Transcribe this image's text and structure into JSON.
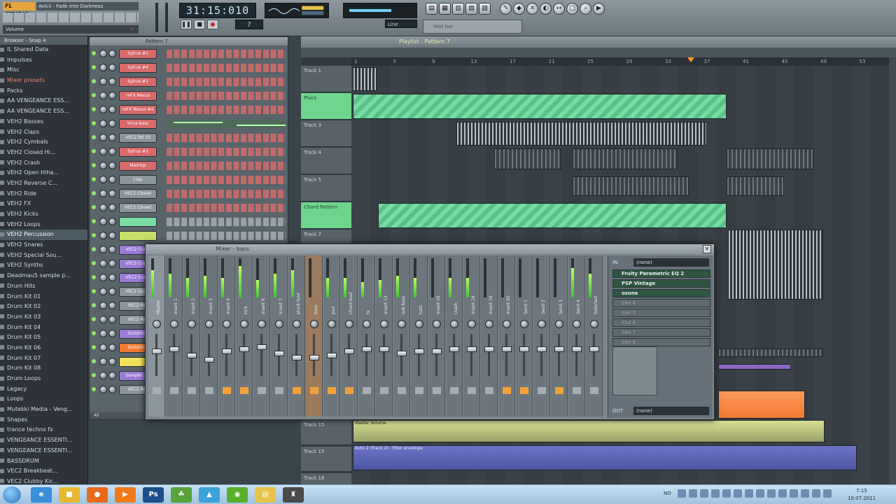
{
  "toolbar": {
    "logo": "FL STUDIO",
    "title": "Avicii - Fade Into Darkness",
    "hint": "Volume",
    "time": "31:15:010",
    "pattern_number": "7",
    "snap": "Line",
    "hint_panel_text": "Hint bar"
  },
  "browser": {
    "header": "Browser - Snap 4",
    "items": [
      {
        "label": "IL Shared Data",
        "style": ""
      },
      {
        "label": "Impulses",
        "style": ""
      },
      {
        "label": "Misc",
        "style": ""
      },
      {
        "label": "Mixer presets",
        "style": "red"
      },
      {
        "label": "Packs",
        "style": ""
      },
      {
        "label": "AA VENGEANCE ESS...",
        "style": ""
      },
      {
        "label": "AA VENGEANCE ESS...",
        "style": ""
      },
      {
        "label": "VEH2 Basses",
        "style": ""
      },
      {
        "label": "VEH2 Claps",
        "style": ""
      },
      {
        "label": "VEH2 Cymbals",
        "style": ""
      },
      {
        "label": "VEH2 Closed Hi...",
        "style": ""
      },
      {
        "label": "VEH2 Crash",
        "style": ""
      },
      {
        "label": "VEH2 Open Hiha...",
        "style": ""
      },
      {
        "label": "VEH2 Reverse C...",
        "style": ""
      },
      {
        "label": "VEH2 Ride",
        "style": ""
      },
      {
        "label": "VEH2 FX",
        "style": ""
      },
      {
        "label": "VEH2 Kicks",
        "style": ""
      },
      {
        "label": "VEH2 Loops",
        "style": ""
      },
      {
        "label": "VEH2 Percussion",
        "style": "sel"
      },
      {
        "label": "VEH2 Snares",
        "style": ""
      },
      {
        "label": "VEH2 Special Sou...",
        "style": ""
      },
      {
        "label": "VEH2 Synths",
        "style": ""
      },
      {
        "label": "Deadmau5 sample p...",
        "style": ""
      },
      {
        "label": "Drum Hits",
        "style": ""
      },
      {
        "label": "Drum Kit 01",
        "style": ""
      },
      {
        "label": "Drum Kit 02",
        "style": ""
      },
      {
        "label": "Drum Kit 03",
        "style": ""
      },
      {
        "label": "Drum Kit 04",
        "style": ""
      },
      {
        "label": "Drum Kit 05",
        "style": ""
      },
      {
        "label": "Drum Kit 06",
        "style": ""
      },
      {
        "label": "Drum Kit 07",
        "style": ""
      },
      {
        "label": "Drum Kit 08",
        "style": ""
      },
      {
        "label": "Drum Loops",
        "style": ""
      },
      {
        "label": "Legacy",
        "style": ""
      },
      {
        "label": "Loops",
        "style": ""
      },
      {
        "label": "Mutekki Media - Veng...",
        "style": ""
      },
      {
        "label": "Shapes",
        "style": ""
      },
      {
        "label": "trance techno fx",
        "style": ""
      },
      {
        "label": "VENGEANCE ESSENTI...",
        "style": ""
      },
      {
        "label": "VENGEANCE ESSENTI...",
        "style": ""
      },
      {
        "label": "BASSDRUM",
        "style": ""
      },
      {
        "label": "VEC2 Breakbeat...",
        "style": ""
      },
      {
        "label": "VEC2 Clubby Kic...",
        "style": ""
      }
    ]
  },
  "sequencer": {
    "title": "Pattern 7",
    "footer": "All",
    "channels": [
      {
        "name": "Sytrus #1",
        "color": "#d86a6a",
        "steps": "red"
      },
      {
        "name": "Sytrus #4",
        "color": "#d86a6a",
        "steps": "red"
      },
      {
        "name": "Sytrus #2",
        "color": "#d86a6a",
        "steps": "red"
      },
      {
        "name": "reFX Nexus",
        "color": "#d86a6a",
        "steps": "red"
      },
      {
        "name": "reFX Nexus #4",
        "color": "#d86a6a",
        "steps": "red"
      },
      {
        "name": "Virus bass",
        "color": "#d86a6a",
        "steps": "roll"
      },
      {
        "name": "VEC2 Bd 10",
        "color": "#8b969c",
        "steps": "red"
      },
      {
        "name": "Sytrus #3",
        "color": "#d86a6a",
        "steps": "red"
      },
      {
        "name": "Mainlop",
        "color": "#d86a6a",
        "steps": "red"
      },
      {
        "name": "Clap",
        "color": "#8b969c",
        "steps": "red"
      },
      {
        "name": "VEC2 Closed",
        "color": "#8b969c",
        "steps": "red"
      },
      {
        "name": "VEC2 Closed",
        "color": "#8b969c",
        "steps": "red"
      },
      {
        "name": "",
        "color": "#79dca2",
        "steps": "grey"
      },
      {
        "name": "",
        "color": "#c7e06a",
        "steps": "grey"
      },
      {
        "name": "VEC2 Crash",
        "color": "#9b7ad8",
        "steps": "grey"
      },
      {
        "name": "VEC2 Crash",
        "color": "#9b7ad8",
        "steps": "grey"
      },
      {
        "name": "VEC2 Crash",
        "color": "#9b7ad8",
        "steps": "grey"
      },
      {
        "name": "VEC2 Ope...",
        "color": "#8b969c",
        "steps": "grey"
      },
      {
        "name": "VEC2 Rev",
        "color": "#8b969c",
        "steps": "grey"
      },
      {
        "name": "VEC2 Rev",
        "color": "#8b969c",
        "steps": "grey"
      },
      {
        "name": "Distortion",
        "color": "#9b7ad8",
        "steps": "grey"
      },
      {
        "name": "Distortion",
        "color": "#ef7a32",
        "steps": "grey"
      },
      {
        "name": "",
        "color": "#f3e05a",
        "steps": "grey"
      },
      {
        "name": "Sampler #1",
        "color": "#9b7ad8",
        "steps": "grey"
      },
      {
        "name": "VEC2 Rev",
        "color": "#8b969c",
        "steps": "grey"
      }
    ]
  },
  "playlist": {
    "title": "Playlist - Pattern 7",
    "timeline": [
      "1",
      "5",
      "9",
      "13",
      "17",
      "21",
      "25",
      "29",
      "33",
      "37",
      "41",
      "45",
      "49",
      "53"
    ],
    "tracks": [
      "Track 1",
      "Pluck",
      "Track 3",
      "Track 4",
      "Track 5",
      "Chord Pattern",
      "Track 7",
      "Track 15",
      "Track 15",
      "Track 16"
    ],
    "automation_clips": [
      "Master Volume",
      "Auto 2 (Track 2) - filter envelope"
    ]
  },
  "mixer": {
    "title": "Mixer - bass",
    "strips": [
      {
        "name": "Master",
        "level": 0.7,
        "fader": 0.35,
        "route": false
      },
      {
        "name": "Insert 1",
        "level": 0.6,
        "fader": 0.3,
        "route": false
      },
      {
        "name": "Insert 2",
        "level": 0.5,
        "fader": 0.45,
        "route": false
      },
      {
        "name": "Insert 3",
        "level": 0.55,
        "fader": 0.55,
        "route": false
      },
      {
        "name": "Insert 4",
        "level": 0.5,
        "fader": 0.35,
        "route": true
      },
      {
        "name": "kick",
        "level": 0.8,
        "fader": 0.3,
        "route": true
      },
      {
        "name": "Insert 6",
        "level": 0.45,
        "fader": 0.25,
        "route": false
      },
      {
        "name": "Insert 7",
        "level": 0.6,
        "fader": 0.4,
        "route": false
      },
      {
        "name": "pluck lead",
        "level": 0.7,
        "fader": 0.5,
        "route": true
      },
      {
        "name": "bass",
        "level": 0.0,
        "fader": 0.5,
        "route": true
      },
      {
        "name": "pad",
        "level": 0.5,
        "fader": 0.45,
        "route": true
      },
      {
        "name": "chord lead",
        "level": 0.5,
        "fader": 0.35,
        "route": true
      },
      {
        "name": "fx",
        "level": 0.4,
        "fader": 0.3,
        "route": false
      },
      {
        "name": "Insert 13",
        "level": 0.45,
        "fader": 0.3,
        "route": false
      },
      {
        "name": "sub bass",
        "level": 0.55,
        "fader": 0.4,
        "route": false
      },
      {
        "name": "hats",
        "level": 0.5,
        "fader": 0.35,
        "route": false
      },
      {
        "name": "Insert 16",
        "level": 0.0,
        "fader": 0.35,
        "route": false
      },
      {
        "name": "crash",
        "level": 0.5,
        "fader": 0.3,
        "route": false
      },
      {
        "name": "Insert 18",
        "level": 0.5,
        "fader": 0.3,
        "route": false
      },
      {
        "name": "Insert 19",
        "level": 0.0,
        "fader": 0.3,
        "route": false
      },
      {
        "name": "Insert 20",
        "level": 0.0,
        "fader": 0.3,
        "route": true
      },
      {
        "name": "Send 1",
        "level": 0.0,
        "fader": 0.3,
        "route": true
      },
      {
        "name": "Send 2",
        "level": 0.0,
        "fader": 0.3,
        "route": false
      },
      {
        "name": "Send 3",
        "level": 0.0,
        "fader": 0.3,
        "route": true
      },
      {
        "name": "Send 4",
        "level": 0.75,
        "fader": 0.3,
        "route": false
      },
      {
        "name": "Selected",
        "level": 0.6,
        "fader": 0.3,
        "route": false
      }
    ],
    "fx": {
      "in_label": "IN",
      "in_value": "(none)",
      "slots": [
        {
          "name": "Fruity Parametric EQ 2",
          "filled": true
        },
        {
          "name": "PSP Vintage",
          "filled": true
        },
        {
          "name": "ozone",
          "filled": true
        },
        {
          "name": "Slot 4",
          "filled": false
        },
        {
          "name": "Slot 5",
          "filled": false
        },
        {
          "name": "Slot 6",
          "filled": false
        },
        {
          "name": "Slot 7",
          "filled": false
        },
        {
          "name": "Slot 8",
          "filled": false
        }
      ],
      "out_label": "OUT",
      "out_value": "(none)"
    }
  },
  "taskbar": {
    "lang": "NO",
    "time": "7:15",
    "date": "10.07.2011",
    "apps": [
      {
        "label": "e",
        "color": "#3b8fd9"
      },
      {
        "label": "■",
        "color": "#e8b830"
      },
      {
        "label": "●",
        "color": "#e86a1a"
      },
      {
        "label": "▶",
        "color": "#f07a1a"
      },
      {
        "label": "Ps",
        "color": "#1d4d8a"
      },
      {
        "label": "☘",
        "color": "#5aa33a"
      },
      {
        "label": "▲",
        "color": "#3aa1d9"
      },
      {
        "label": "◉",
        "color": "#58b02a"
      },
      {
        "label": "▤",
        "color": "#e6c44a"
      },
      {
        "label": "♜",
        "color": "#4a4a4a"
      }
    ]
  },
  "colors": {
    "accent_green": "#79dca2",
    "accent_orange": "#ef7a32",
    "accent_purple": "#8e68c5"
  }
}
